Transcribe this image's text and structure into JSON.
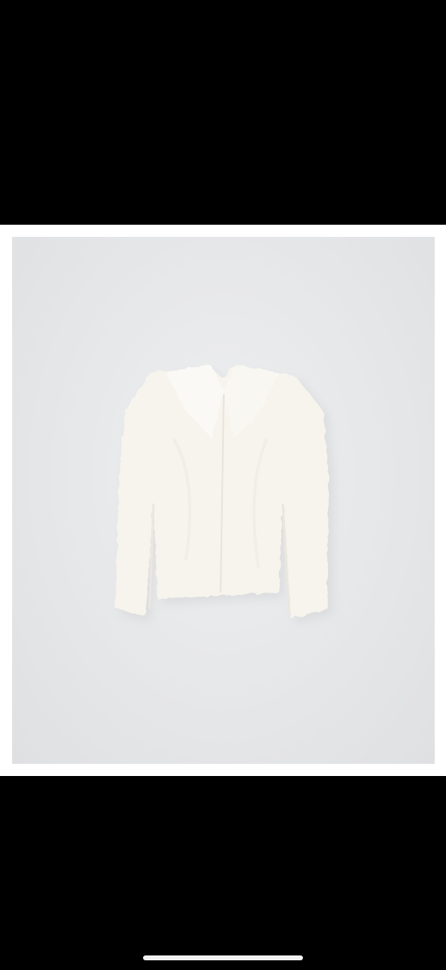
{
  "viewer": {
    "background_color": "#000000",
    "frame_color": "#ffffff",
    "photo_background": "#e6e7e9"
  },
  "photo": {
    "subject_icon": "fur-jacket-icon",
    "jacket_color": "#f7f4ee"
  },
  "system": {
    "home_indicator_color": "#f2f2f2"
  }
}
